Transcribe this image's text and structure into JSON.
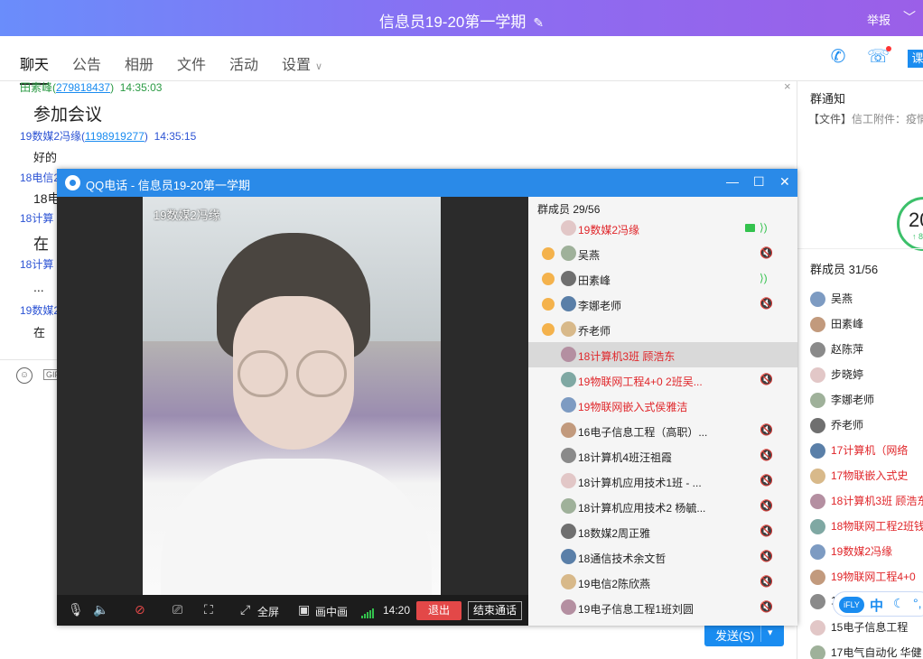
{
  "titlebar": {
    "title": "信息员19-20第一学期",
    "edit_icon": "✎",
    "report": "举报",
    "chevron": "﹀"
  },
  "tabs": [
    {
      "label": "聊天"
    },
    {
      "label": "公告"
    },
    {
      "label": "相册"
    },
    {
      "label": "文件"
    },
    {
      "label": "活动"
    },
    {
      "label": "设置"
    }
  ],
  "toolbar_icons": {
    "phone": "✆",
    "video_call": "☏",
    "course": "课"
  },
  "chat": {
    "messages": [
      {
        "sender": "田素峰(",
        "qq": "279818437",
        "after": ")",
        "time": "14:35:03",
        "text": "参加会议"
      },
      {
        "sender": "19数媒2冯缘(",
        "qq": "1198919277",
        "after": ")",
        "time": "14:35:15",
        "text": "好的"
      },
      {
        "sender": "18电信2",
        "text": "18电"
      },
      {
        "sender": "18计算",
        "text": "在"
      },
      {
        "sender": "18计算",
        "text": "..."
      },
      {
        "sender": "19数媒2",
        "text": "在"
      }
    ],
    "close": "×"
  },
  "input": {
    "gif": "GIF",
    "send": "发送(S)",
    "send_arrow": "▾"
  },
  "right_panel": {
    "notice_title": "群通知",
    "notice_tag": "【文件】",
    "notice_text": "信工附件：疫情",
    "ring_num": "20",
    "ring_sub": "↑ 8",
    "members_title": "群成员 31/56",
    "members": [
      {
        "name": "吴燕",
        "red": false
      },
      {
        "name": "田素峰",
        "red": false
      },
      {
        "name": "赵陈萍",
        "red": false
      },
      {
        "name": "步晓婷",
        "red": false
      },
      {
        "name": "李娜老师",
        "red": false
      },
      {
        "name": "乔老师",
        "red": false
      },
      {
        "name": "17计算机（网络",
        "red": true
      },
      {
        "name": "17物联嵌入式史",
        "red": true
      },
      {
        "name": "18计算机3班 顾浩东",
        "red": true
      },
      {
        "name": "18物联网工程2班钱",
        "red": true
      },
      {
        "name": "19数媒2冯缘",
        "red": true
      },
      {
        "name": "19物联网工程4+0",
        "red": true
      },
      {
        "name": "1",
        "red": false
      },
      {
        "name": "15电子信息工程",
        "red": false
      },
      {
        "name": "17电气自动化 华健",
        "red": false
      }
    ]
  },
  "ifly": {
    "logo": "iFLY",
    "zh": "中",
    "moon": "☾",
    "dot": "°,"
  },
  "call": {
    "title": "QQ电话 - 信息员19-20第一学期",
    "min": "—",
    "max": "☐",
    "close": "✕",
    "speaker_name": "19数媒2冯缘",
    "controls": {
      "fullscreen": "全屏",
      "pip": "画中画",
      "duration": "14:20",
      "exit": "退出",
      "end": "结束通话"
    },
    "members_title": "群成员 29/56",
    "members": [
      {
        "name": "19数媒2冯缘",
        "red": true,
        "admin": false,
        "status": "video",
        "sel": false
      },
      {
        "name": "吴燕",
        "red": false,
        "admin": true,
        "status": "mute",
        "sel": false
      },
      {
        "name": "田素峰",
        "red": false,
        "admin": true,
        "status": "speaking",
        "sel": false
      },
      {
        "name": "李娜老师",
        "red": false,
        "admin": true,
        "status": "mute",
        "sel": false
      },
      {
        "name": "乔老师",
        "red": false,
        "admin": true,
        "status": "",
        "sel": false
      },
      {
        "name": "18计算机3班 顾浩东",
        "red": true,
        "admin": false,
        "status": "",
        "sel": true
      },
      {
        "name": "19物联网工程4+0  2班吴...",
        "red": true,
        "admin": false,
        "status": "mute",
        "sel": false
      },
      {
        "name": "19物联网嵌入式侯雅洁",
        "red": true,
        "admin": false,
        "status": "",
        "sel": false
      },
      {
        "name": "16电子信息工程（高职）...",
        "red": false,
        "admin": false,
        "status": "mute",
        "sel": false
      },
      {
        "name": "18计算机4班汪祖霞",
        "red": false,
        "admin": false,
        "status": "mute",
        "sel": false
      },
      {
        "name": "18计算机应用技术1班 - ...",
        "red": false,
        "admin": false,
        "status": "mute",
        "sel": false
      },
      {
        "name": "18计算机应用技术2 杨毓...",
        "red": false,
        "admin": false,
        "status": "mute",
        "sel": false
      },
      {
        "name": "18数媒2周正雅",
        "red": false,
        "admin": false,
        "status": "mute",
        "sel": false
      },
      {
        "name": "18通信技术余文哲",
        "red": false,
        "admin": false,
        "status": "mute",
        "sel": false
      },
      {
        "name": "19电信2陈欣燕",
        "red": false,
        "admin": false,
        "status": "mute",
        "sel": false
      },
      {
        "name": "19电子信息工程1班刘圆",
        "red": false,
        "admin": false,
        "status": "mute",
        "sel": false
      }
    ]
  },
  "colors": {
    "accent": "#1a8cf0",
    "red": "#e0262a",
    "green": "#33c24d",
    "title_bar": "#2a8ae8"
  }
}
